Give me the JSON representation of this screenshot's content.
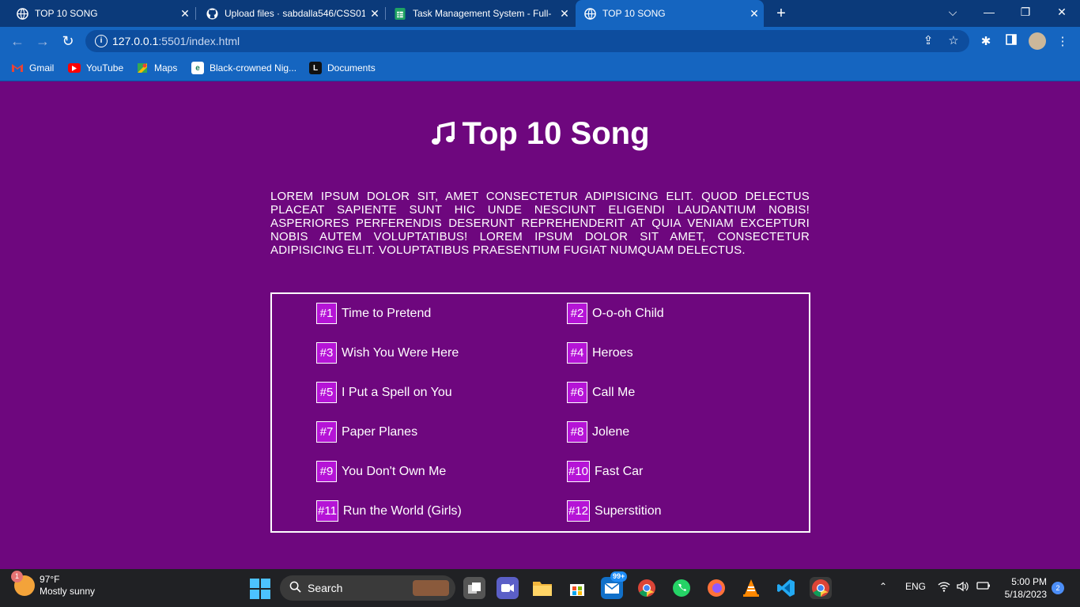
{
  "browser": {
    "tabs": [
      {
        "title": "TOP 10 SONG",
        "active": false,
        "icon": "globe-icon"
      },
      {
        "title": "Upload files · sabdalla546/CSS01",
        "active": false,
        "icon": "github-icon"
      },
      {
        "title": "Task Management System - Full-",
        "active": false,
        "icon": "sheets-icon"
      },
      {
        "title": "TOP 10 SONG",
        "active": true,
        "icon": "globe-icon"
      }
    ],
    "address": {
      "host": "127.0.0.1",
      "path": ":5501/index.html"
    },
    "bookmarks": [
      {
        "label": "Gmail",
        "icon": "gmail-icon"
      },
      {
        "label": "YouTube",
        "icon": "youtube-icon"
      },
      {
        "label": "Maps",
        "icon": "maps-icon"
      },
      {
        "label": "Black-crowned Nig...",
        "icon": "e-icon"
      },
      {
        "label": "Documents",
        "icon": "docs-icon"
      }
    ],
    "colors": {
      "tabbar": "#0b3a7a",
      "toolbar": "#1565c0"
    }
  },
  "page": {
    "title": "Top 10 Song",
    "description": "Lorem ipsum dolor sit, amet consectetur adipisicing elit. Quod delectus placeat sapiente sunt hic unde nesciunt eligendi laudantium nobis! Asperiores perferendis deserunt reprehenderit at quia veniam excepturi nobis autem voluptatibus! Lorem ipsum dolor sit amet, consectetur adipisicing elit. Voluptatibus praesentium fugiat numquam delectus.",
    "songs": [
      {
        "rank": "#1",
        "name": "Time to Pretend"
      },
      {
        "rank": "#2",
        "name": "O-o-oh Child"
      },
      {
        "rank": "#3",
        "name": "Wish You Were Here"
      },
      {
        "rank": "#4",
        "name": "Heroes"
      },
      {
        "rank": "#5",
        "name": "I Put a Spell on You"
      },
      {
        "rank": "#6",
        "name": "Call Me"
      },
      {
        "rank": "#7",
        "name": "Paper Planes"
      },
      {
        "rank": "#8",
        "name": "Jolene"
      },
      {
        "rank": "#9",
        "name": "You Don't Own Me"
      },
      {
        "rank": "#10",
        "name": "Fast Car"
      },
      {
        "rank": "#11",
        "name": "Run the World (Girls)"
      },
      {
        "rank": "#12",
        "name": "Superstition"
      }
    ],
    "colors": {
      "background": "#6e077e",
      "rank_badge": "#b514d6"
    }
  },
  "taskbar": {
    "weather": {
      "temp": "97°F",
      "condition": "Mostly sunny",
      "badge": "1"
    },
    "search_label": "Search",
    "mail_badge": "99+",
    "language": "ENG",
    "time": "5:00 PM",
    "date": "5/18/2023",
    "notifications": "2"
  }
}
